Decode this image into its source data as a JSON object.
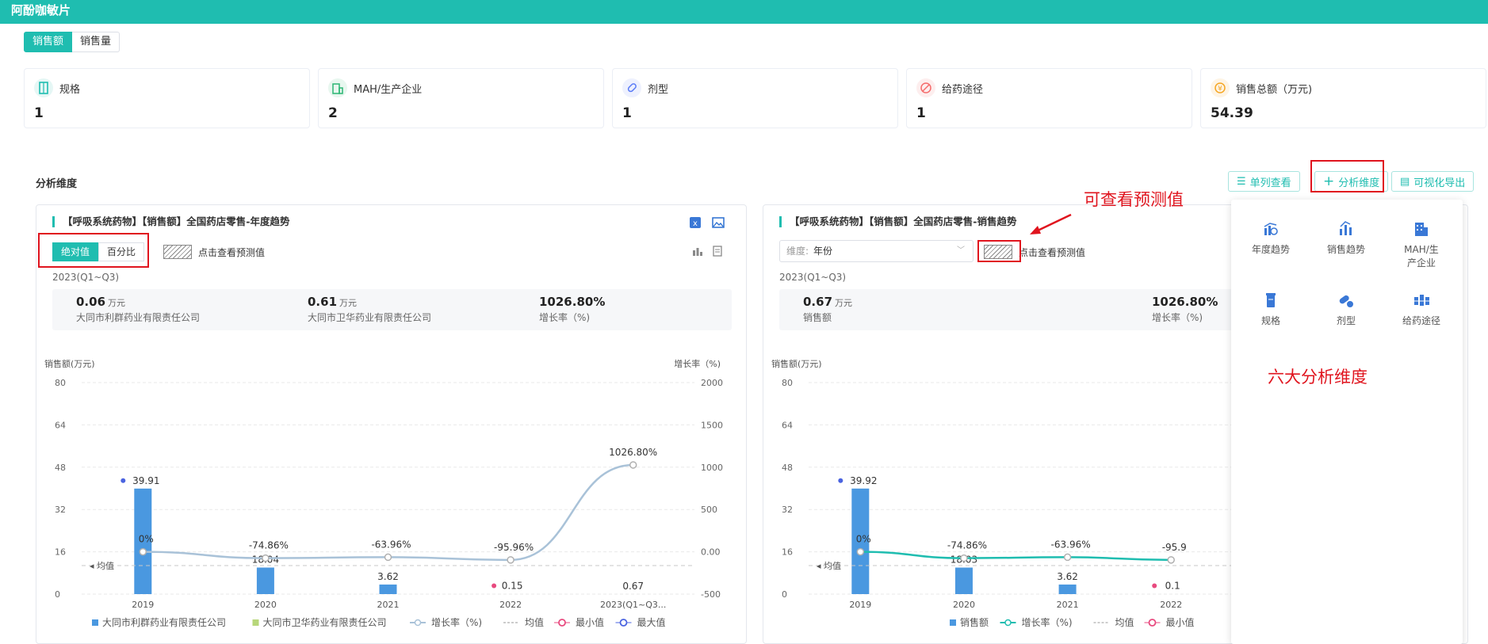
{
  "header": {
    "title": "阿酚咖敏片"
  },
  "tabs": [
    {
      "label": "销售额"
    },
    {
      "label": "销售量"
    }
  ],
  "stats": [
    {
      "label": "规格",
      "value": "1",
      "icon": "spec-icon",
      "color": "#1fbdb0"
    },
    {
      "label": "MAH/生产企业",
      "value": "2",
      "icon": "building-icon",
      "color": "#2bb673"
    },
    {
      "label": "剂型",
      "value": "1",
      "icon": "pill-icon",
      "color": "#5b7cf7"
    },
    {
      "label": "给药途径",
      "value": "1",
      "icon": "route-icon",
      "color": "#f56c6c"
    },
    {
      "label": "销售总额（万元)",
      "value": "54.39",
      "icon": "money-icon",
      "color": "#f5a623"
    }
  ],
  "section": {
    "title": "分析维度"
  },
  "toolbar": {
    "single_view": "单列查看",
    "add_dimension": "分析维度",
    "export": "可视化导出"
  },
  "annotations": {
    "predict": "可查看预测值",
    "six": "六大分析维度"
  },
  "panel": {
    "items": [
      {
        "label": "年度趋势",
        "icon": "annual-trend-icon"
      },
      {
        "label": "销售趋势",
        "icon": "sales-trend-icon"
      },
      {
        "label": "MAH/生\n产企业",
        "icon": "enterprise-icon"
      },
      {
        "label": "规格",
        "icon": "spec-icon"
      },
      {
        "label": "剂型",
        "icon": "dosage-form-icon"
      },
      {
        "label": "给药途径",
        "icon": "route-icon"
      }
    ]
  },
  "card1": {
    "title": "【呼吸系统药物】【销售额】全国药店零售-年度趋势",
    "seg": [
      "绝对值",
      "百分比"
    ],
    "predict": "点击查看预测值",
    "period": "2023(Q1~Q3)",
    "summary": [
      {
        "num": "0.06",
        "unit": "万元",
        "desc": "大同市利群药业有限责任公司"
      },
      {
        "num": "0.61",
        "unit": "万元",
        "desc": "大同市卫华药业有限责任公司"
      },
      {
        "num": "1026.80%",
        "unit": "",
        "desc": "增长率（%)"
      }
    ],
    "ylabel": "销售额(万元)",
    "y2label": "增长率（%)",
    "legend": [
      "大同市利群药业有限责任公司",
      "大同市卫华药业有限责任公司",
      "增长率（%)",
      "均值",
      "最小值",
      "最大值"
    ]
  },
  "card2": {
    "title": "【呼吸系统药物】【销售额】全国药店零售-销售趋势",
    "select_prefix": "维度:",
    "select_value": "年份",
    "predict": "点击查看预测值",
    "period": "2023(Q1~Q3)",
    "summary": [
      {
        "num": "0.67",
        "unit": "万元",
        "desc": "销售额"
      },
      {
        "num": "1026.80%",
        "unit": "",
        "desc": "增长率（%)"
      }
    ],
    "ylabel": "销售额(万元)",
    "legend": [
      "销售额",
      "增长率（%)",
      "均值",
      "最小值"
    ]
  },
  "chart_data": [
    {
      "type": "bar",
      "categories": [
        "2019",
        "2020",
        "2021",
        "2022",
        "2023(Q1~Q3..."
      ],
      "series": [
        {
          "name": "大同市利群药业有限责任公司",
          "values": [
            39.91,
            10.04,
            3.62,
            0.15,
            0.06
          ]
        },
        {
          "name": "大同市卫华药业有限责任公司",
          "values": [
            0,
            0,
            0,
            0,
            0.61
          ]
        },
        {
          "name": "增长率（%)",
          "values": [
            0,
            -74.86,
            -63.96,
            -95.96,
            1026.8
          ]
        }
      ],
      "data_labels": [
        "39.91",
        "18.04",
        "3.62",
        "0.15",
        "0.67"
      ],
      "growth_labels": [
        "0%",
        "-74.86%",
        "-63.96%",
        "-95.96%",
        "1026.80%"
      ],
      "ylabel": "销售额(万元)",
      "y2label": "增长率（%)",
      "ylim": [
        0,
        80
      ],
      "yticks": [
        "0",
        "16",
        "32",
        "48",
        "64",
        "80"
      ],
      "y2lim": [
        -500,
        2000
      ],
      "y2ticks": [
        "-500",
        "0.00",
        "500",
        "1000",
        "1500",
        "2000"
      ],
      "mean_label": "均值",
      "line_color": "#a9c2d8",
      "bar_color": "#4a98e0"
    },
    {
      "type": "bar",
      "categories": [
        "2019",
        "2020",
        "2021",
        "2022"
      ],
      "series": [
        {
          "name": "销售额",
          "values": [
            39.92,
            10.03,
            3.62,
            0.15
          ]
        },
        {
          "name": "增长率（%)",
          "values": [
            0,
            -74.86,
            -63.96,
            -95.96
          ]
        }
      ],
      "data_labels": [
        "39.92",
        "18.03",
        "3.62",
        "0.1"
      ],
      "growth_labels": [
        "0%",
        "-74.86%",
        "-63.96%",
        "-95.9"
      ],
      "ylabel": "销售额(万元)",
      "ylim": [
        0,
        80
      ],
      "yticks": [
        "0",
        "16",
        "32",
        "48",
        "64",
        "80"
      ],
      "mean_label": "均值",
      "line_color": "#1fbdb0",
      "bar_color": "#4a98e0"
    }
  ]
}
